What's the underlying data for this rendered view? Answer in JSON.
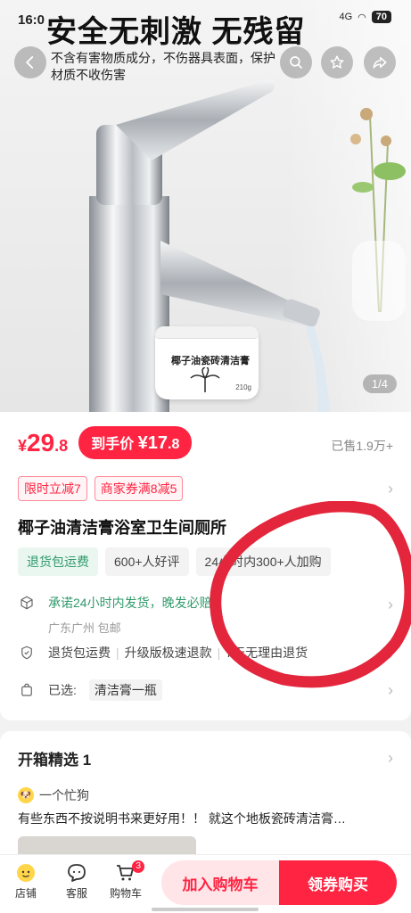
{
  "status": {
    "time": "16:0",
    "signal": "4G",
    "battery": "70"
  },
  "hero": {
    "headline": "安全无刺激 无残留",
    "subline": "不含有害物质成分，不伤器具表面，保护材质不收伤害",
    "product_label": "椰子油瓷砖清洁膏",
    "product_weight": "210g",
    "pager": "1/4"
  },
  "price": {
    "currency": "¥",
    "int": "29",
    "dec": ".8",
    "final_label": "到手价",
    "final_int": "¥17",
    "final_dec": ".8",
    "sold": "已售1.9万+"
  },
  "promos": [
    "限时立减7",
    "商家券满8减5"
  ],
  "title": "椰子油清洁膏浴室卫生间厕所",
  "tags": [
    "退货包运费",
    "600+人好评",
    "24小时内300+人加购"
  ],
  "shipping": {
    "text": "承诺24小时内发货，晚发必赔",
    "location": "广东广州 包邮"
  },
  "services": [
    "退货包运费",
    "升级版极速退款",
    "7天无理由退货"
  ],
  "selected": {
    "label": "已选:",
    "value": "清洁膏一瓶"
  },
  "review": {
    "header": "开箱精选 1",
    "user": "一个忙狗",
    "text": "有些东西不按说明书来更好用！！ 就这个地板瓷砖清洁膏…"
  },
  "bottom": {
    "shop": "店铺",
    "service": "客服",
    "cart": "购物车",
    "cart_badge": "3",
    "add_cart": "加入购物车",
    "buy": "领券购买"
  },
  "colors": {
    "accent": "#ff2442",
    "green": "#2f9a6a"
  }
}
